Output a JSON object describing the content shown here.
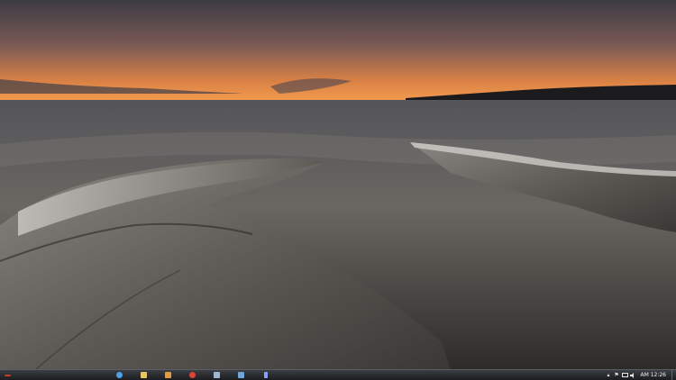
{
  "desktop": {
    "wallpaper": "rocky-shore-sunset",
    "colors": {
      "sky_top": "#3b3b44",
      "sky_glow": "#e2793a",
      "water": "#5f5a55",
      "rock": "#6e6a66"
    }
  },
  "taskbar": {
    "start_icon": "windows-start-icon",
    "pinned": [
      {
        "name": "internet-explorer-icon",
        "color": "#4aa3e8"
      },
      {
        "name": "folder-icon",
        "color": "#e7c562"
      },
      {
        "name": "media-player-icon",
        "color": "#e59a3b"
      },
      {
        "name": "chrome-icon",
        "color": "#d8443a"
      },
      {
        "name": "monitor-icon",
        "color": "#9fb8d0"
      },
      {
        "name": "network-icon",
        "color": "#6fa6d6"
      },
      {
        "name": "document-icon",
        "color": "#8aa0ff"
      }
    ],
    "tray": {
      "chevron": "▴",
      "flag": "⚑",
      "clock": "AM 12:26"
    }
  }
}
